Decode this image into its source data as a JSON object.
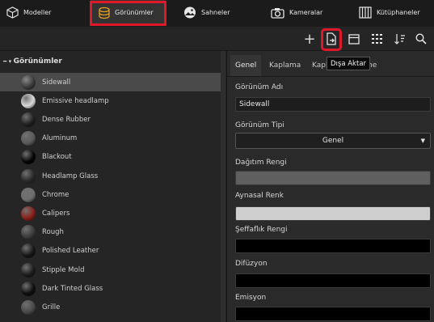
{
  "top_tabs": [
    {
      "label": "Modeller",
      "icon": "cube-icon"
    },
    {
      "label": "Görünümler",
      "icon": "material-sphere-icon"
    },
    {
      "label": "Sahneler",
      "icon": "landscape-icon"
    },
    {
      "label": "Kameralar",
      "icon": "camera-icon"
    },
    {
      "label": "Kütüphaneler",
      "icon": "library-icon"
    }
  ],
  "toolbar": {
    "add": "+",
    "tooltip": "Dışa Aktar"
  },
  "tree": {
    "header": "Görünümler",
    "items": [
      {
        "label": "Sidewall",
        "color": "#3a3a3a"
      },
      {
        "label": "Emissive headlamp",
        "color": "#d8d8d8"
      },
      {
        "label": "Dense Rubber",
        "color": "#202020"
      },
      {
        "label": "Aluminum",
        "color": "#5a5a5a"
      },
      {
        "label": "Blackout",
        "color": "#050505"
      },
      {
        "label": "Headlamp Glass",
        "color": "#2a2a2a"
      },
      {
        "label": "Chrome",
        "color": "#6e6e6e"
      },
      {
        "label": "Calipers",
        "color": "#8a1f1a"
      },
      {
        "label": "Rough",
        "color": "#3c3c3c"
      },
      {
        "label": "Polished Leather",
        "color": "#161616"
      },
      {
        "label": "Stipple Mold",
        "color": "#1c1c1c"
      },
      {
        "label": "Dark Tinted Glass",
        "color": "#0e0e0e"
      },
      {
        "label": "Grille",
        "color": "#4a4a4a"
      }
    ]
  },
  "props": {
    "tabs": [
      "Genel",
      "Kaplama",
      "Kapl",
      "me"
    ],
    "name_label": "Görünüm Adı",
    "name_value": "Sidewall",
    "type_label": "Görünüm Tipi",
    "type_value": "Genel",
    "diffuse_label": "Dağıtım Rengi",
    "diffuse_color": "#5f5f5f",
    "specular_label": "Aynasal Renk",
    "specular_color": "#cfcfcf",
    "transparent_label": "Şeffaflık Rengi",
    "transparent_color": "#000000",
    "diffusion_label": "Difüzyon",
    "diffusion_color": "#000000",
    "emission_label": "Emisyon",
    "emission_color": "#000000"
  },
  "accent_color": "#e0192a"
}
